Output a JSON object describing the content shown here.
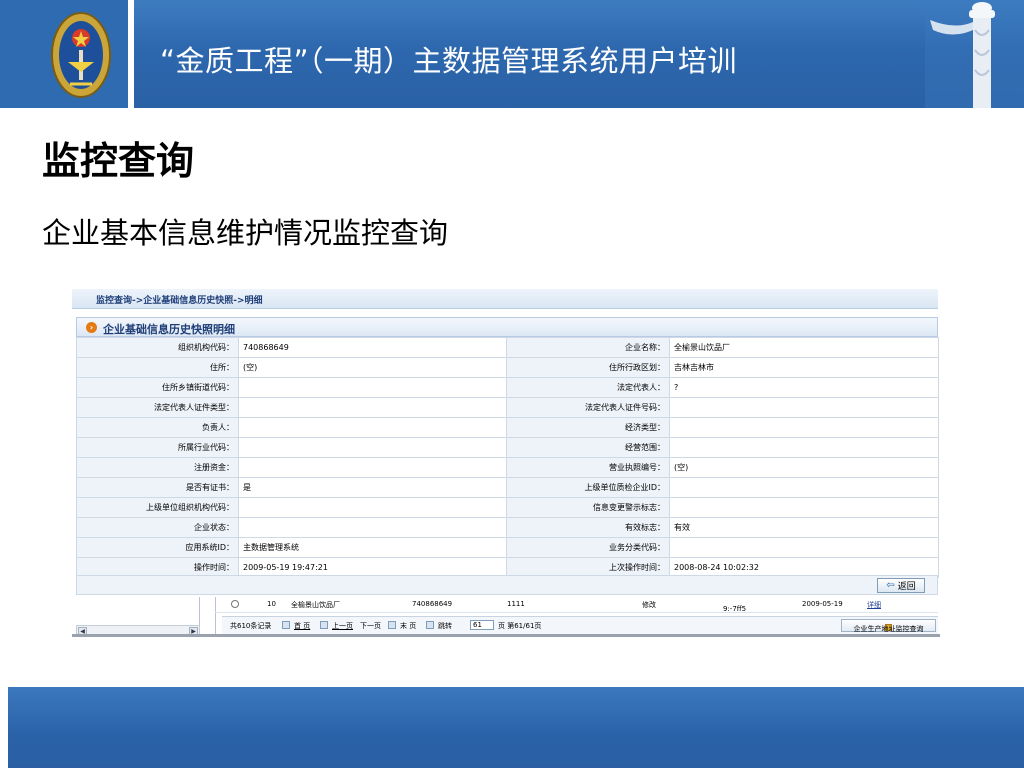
{
  "slide": {
    "header_title": "“金质工程”（一期）主数据管理系统用户培训",
    "heading": "监控查询",
    "subheading": "企业基本信息维护情况监控查询"
  },
  "app": {
    "breadcrumb": "监控查询->企业基础信息历史快照->明细",
    "panel_title": "企业基础信息历史快照明细",
    "fields": [
      {
        "label1": "组织机构代码：",
        "value1": "740868649",
        "label2": "企业名称：",
        "value2": "全榆景山饮品厂"
      },
      {
        "label1": "住所：",
        "value1": "(空)",
        "label2": "住所行政区划：",
        "value2": "吉林吉林市"
      },
      {
        "label1": "住所乡镇街道代码：",
        "value1": "",
        "label2": "法定代表人：",
        "value2": "?"
      },
      {
        "label1": "法定代表人证件类型：",
        "value1": "",
        "label2": "法定代表人证件号码：",
        "value2": ""
      },
      {
        "label1": "负责人：",
        "value1": "",
        "label2": "经济类型：",
        "value2": ""
      },
      {
        "label1": "所属行业代码：",
        "value1": "",
        "label2": "经营范围：",
        "value2": ""
      },
      {
        "label1": "注册资金：",
        "value1": "",
        "label2": "营业执照编号：",
        "value2": "(空)"
      },
      {
        "label1": "是否有证书：",
        "value1": "是",
        "label2": "上级单位质检企业ID：",
        "value2": ""
      },
      {
        "label1": "上级单位组织机构代码：",
        "value1": "",
        "label2": "信息变更警示标志：",
        "value2": ""
      },
      {
        "label1": "企业状态：",
        "value1": "",
        "label2": "有效标志：",
        "value2": "有效"
      },
      {
        "label1": "应用系统ID：",
        "value1": "主数据管理系统",
        "label2": "业务分类代码：",
        "value2": ""
      },
      {
        "label1": "操作时间：",
        "value1": "2009-05-19 19:47:21",
        "label2": "上次操作时间：",
        "value2": "2008-08-24 10:02:32"
      }
    ],
    "back_button": "返回",
    "list_row": {
      "index": "10",
      "name": "全榆景山饮品厂",
      "code": "740868649",
      "num": "1111",
      "op": "修改",
      "id_tail": "9:-7ff5",
      "date": "2009-05-19",
      "link": "详细"
    },
    "pager": {
      "total": "共610条记录",
      "first": "首 页",
      "prev": "上一页",
      "next": "下一页",
      "last": "末 页",
      "jump": "跳转",
      "page_value": "61",
      "page_info": "页 第61/61页",
      "addr_button": "企业生产地址监控查询"
    }
  }
}
